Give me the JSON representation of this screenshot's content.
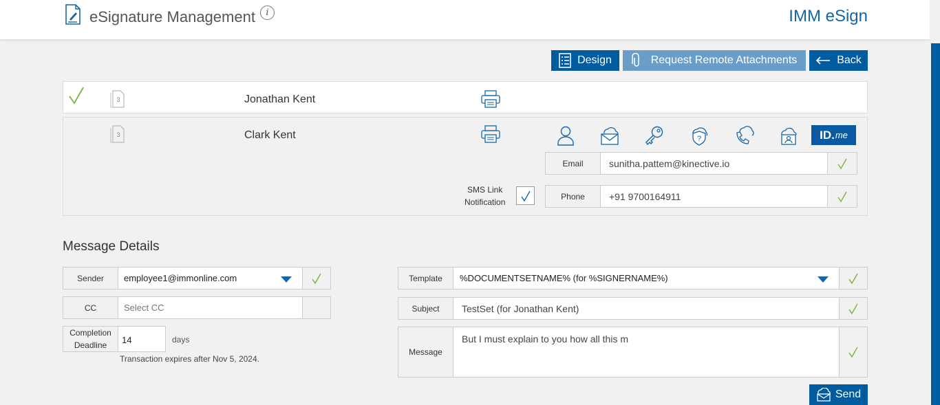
{
  "header": {
    "title": "eSignature Management",
    "info": "i",
    "brand": "IMM eSign"
  },
  "toolbar": {
    "design_label": "Design",
    "remote_label": "Request Remote Attachments",
    "back_label": "Back"
  },
  "signers": [
    {
      "name": "Jonathan Kent",
      "signed": true,
      "doc_count": "3"
    },
    {
      "name": "Clark Kent",
      "signed": false,
      "doc_count": "3"
    }
  ],
  "auth_options": {
    "icons": [
      "user-icon",
      "email-auth-icon",
      "key-icon",
      "security-question-icon",
      "phone-auth-icon",
      "id-cloud-icon"
    ],
    "idme_main": "ID.",
    "idme_suffix": "me"
  },
  "contact": {
    "email_label": "Email",
    "email_value": "sunitha.pattem@kinective.io",
    "phone_label": "Phone",
    "phone_value": "+91 9700164911",
    "sms_label_line1": "SMS Link",
    "sms_label_line2": "Notification",
    "sms_checked": true
  },
  "message_details": {
    "section_title": "Message Details",
    "sender_label": "Sender",
    "sender_value": "employee1@immonline.com",
    "cc_label": "CC",
    "cc_placeholder": "Select CC",
    "deadline_label_line1": "Completion",
    "deadline_label_line2": "Deadline",
    "deadline_value": "14",
    "days_label": "days",
    "expires_text": "Transaction expires after Nov 5, 2024.",
    "template_label": "Template",
    "template_value": "%DOCUMENTSETNAME% (for %SIGNERNAME%)",
    "subject_label": "Subject",
    "subject_value": "TestSet (for Jonathan Kent)",
    "message_label": "Message",
    "message_value": "But I must explain to you how all this m",
    "send_label": "Send"
  },
  "colors": {
    "primary": "#005b9f",
    "primary_light": "#6a9ec8",
    "check_green": "#7cb342",
    "check_blue": "#1565a8",
    "icon_blue": "#1565a8"
  }
}
